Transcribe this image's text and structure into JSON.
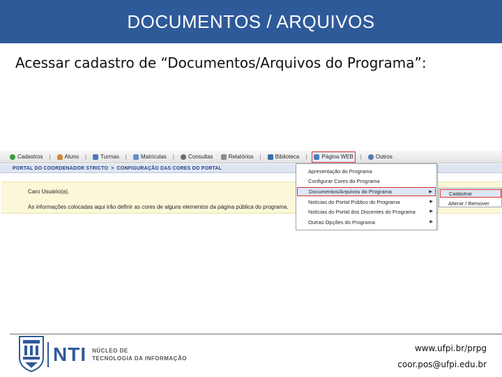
{
  "slide": {
    "title": "DOCUMENTOS / ARQUIVOS",
    "instruction": "Acessar cadastro de “Documentos/Arquivos do Programa”:"
  },
  "menubar": {
    "items": [
      {
        "label": "Cadastros",
        "icon": "plus-circle-icon",
        "color": "#3a9a3a"
      },
      {
        "label": "Aluno",
        "icon": "user-icon",
        "color": "#c98a3a"
      },
      {
        "label": "Turmas",
        "icon": "group-icon",
        "color": "#4c79b8"
      },
      {
        "label": "Matrículas",
        "icon": "document-icon",
        "color": "#5f8fc9"
      },
      {
        "label": "Consultas",
        "icon": "search-icon",
        "color": "#6d6d6d"
      },
      {
        "label": "Relatórios",
        "icon": "report-icon",
        "color": "#8c8c8c"
      },
      {
        "label": "Biblioteca",
        "icon": "library-icon",
        "color": "#3a6ea8"
      },
      {
        "label": "Página WEB",
        "icon": "web-icon",
        "color": "#4a7fc2"
      },
      {
        "label": "Outros",
        "icon": "other-icon",
        "color": "#4c79b8"
      }
    ]
  },
  "breadcrumb": {
    "part1": "Portal do Coordenador Stricto",
    "separator": ">",
    "part2": "Configuração das Cores do Portal"
  },
  "info": {
    "line1": "Caro Usuário(a),",
    "line2": "As informações colocadas aqui irão definir as cores de alguns elementos da página pública do programa."
  },
  "dropdown": {
    "items": [
      {
        "label": "Apresentação do Programa"
      },
      {
        "label": "Configurar Cores do Programa"
      },
      {
        "label": "Documentos/Arquivos do Programa"
      },
      {
        "label": "Notícias do Portal Público do Programa"
      },
      {
        "label": "Notícias do Portal dos Discentes do Programa"
      },
      {
        "label": "Outras Opções do Programa"
      }
    ]
  },
  "submenu": {
    "items": [
      {
        "label": "Cadastrar"
      },
      {
        "label": "Alterar / Remover"
      }
    ]
  },
  "footer": {
    "nti": "NTI",
    "nti_line1": "NÚCLEO DE",
    "nti_line2": "TECNOLOGIA DA INFORMAÇÃO",
    "url": "www.ufpi.br/prpg",
    "email": "coor.pos@ufpi.edu.br"
  },
  "colors": {
    "header_bg": "#2f5a9a",
    "highlight_border": "#d9322b",
    "info_bg": "#fbf8d9",
    "breadcrumb_text": "#23408a"
  }
}
